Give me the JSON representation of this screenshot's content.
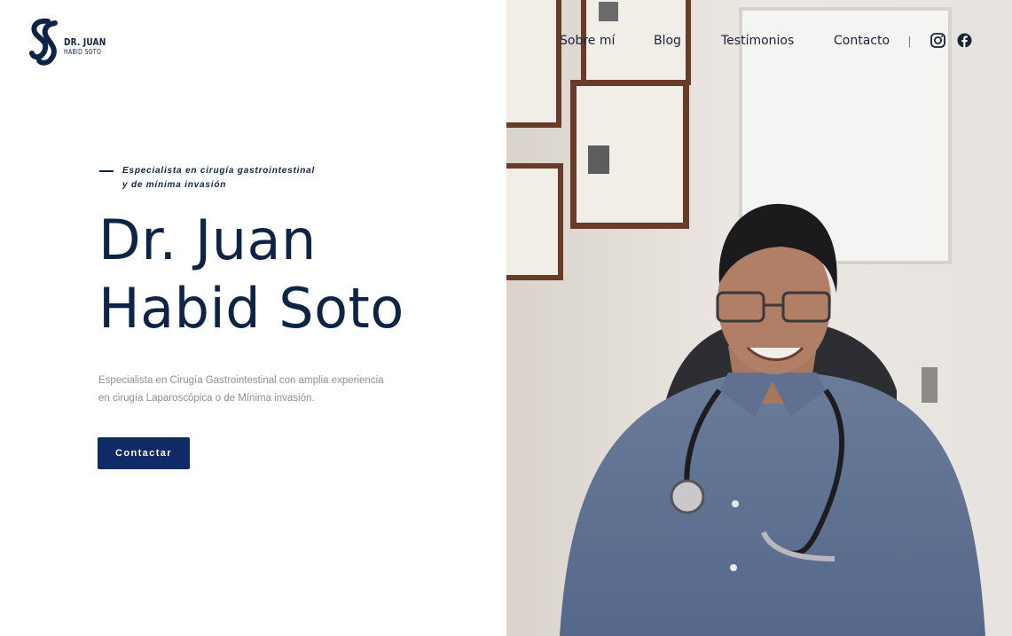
{
  "logo": {
    "line1": "DR. JUAN",
    "line2": "HABID SOTO",
    "icon": "double-s-monogram-icon"
  },
  "nav": {
    "items": [
      {
        "label": "Sobre mí"
      },
      {
        "label": "Blog"
      },
      {
        "label": "Testimonios"
      },
      {
        "label": "Contacto"
      }
    ],
    "social": [
      "instagram-icon",
      "facebook-icon"
    ]
  },
  "hero": {
    "tagline": [
      "Especialista en cirugía gastrointestinal",
      "y de mínima invasión"
    ],
    "title": [
      "Dr. Juan",
      "Habid Soto"
    ],
    "description": [
      "Especialista en Cirugía Gastrointestinal con amplia experiencia",
      "en cirugía Laparoscópica o de Mínima invasión."
    ],
    "cta_label": "Contactar"
  },
  "colors": {
    "primary": "#0d2447",
    "button": "#0f2a64",
    "muted_text": "#8a8f99"
  },
  "photo": {
    "subject": "doctor-portrait-photo"
  }
}
